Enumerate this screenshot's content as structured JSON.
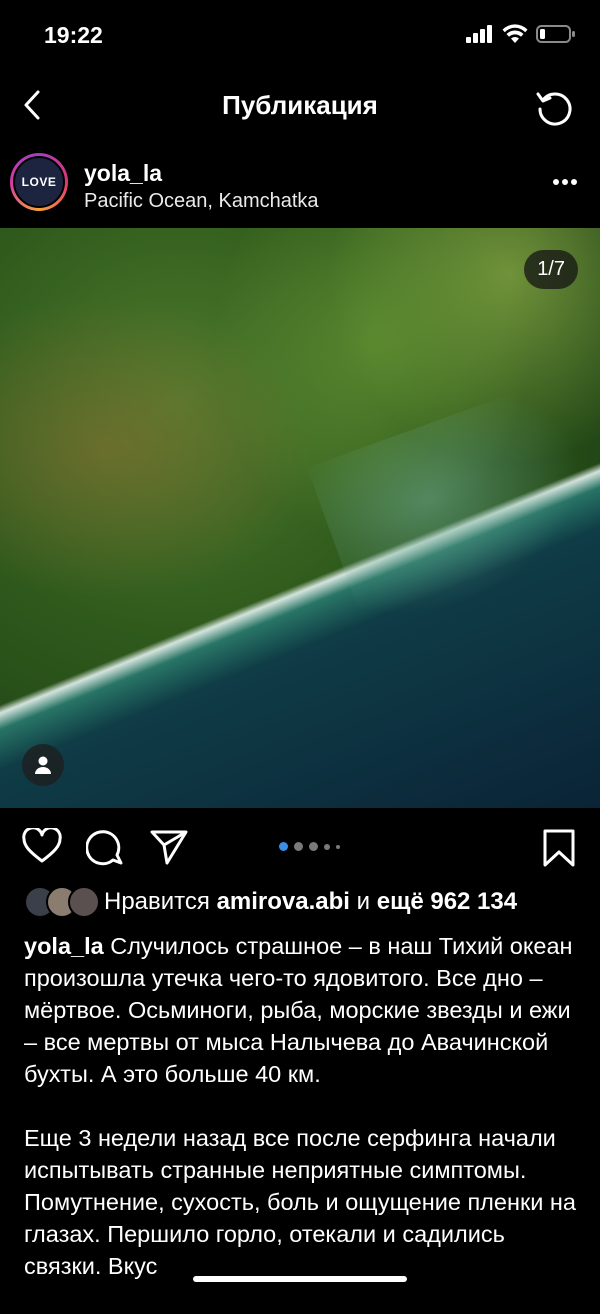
{
  "status_bar": {
    "time": "19:22",
    "signal_icon": "cellular-signal-icon",
    "wifi_icon": "wifi-icon",
    "battery_icon": "battery-low-icon"
  },
  "nav": {
    "title": "Публикация",
    "back_icon": "chevron-left-icon",
    "refresh_icon": "refresh-icon"
  },
  "post": {
    "username": "yola_la",
    "location": "Pacific Ocean, Kamchatka",
    "avatar_text": "LOVE",
    "more_icon": "more-dots-icon",
    "photo_counter": "1/7",
    "carousel": {
      "total_dots": 5,
      "active_index": 0
    }
  },
  "actions": {
    "like_icon": "heart-icon",
    "comment_icon": "comment-icon",
    "share_icon": "send-icon",
    "save_icon": "bookmark-icon"
  },
  "likes": {
    "prefix": "Нравится",
    "user": "amirova.abi",
    "middle": "и",
    "more": "ещё 962 134"
  },
  "caption": {
    "username": "yola_la",
    "paragraph1": "Случилось страшное – в наш Тихий океан произошла утечка чего-то ядовитого. Все дно – мёртвое. Осьминоги, рыба, морские звезды и ежи – все мертвы от мыса Налычева до Авачинской бухты. А это больше 40 км.",
    "paragraph2": "Еще 3 недели назад все после серфинга начали испытывать странные неприятные симптомы. Помутнение, сухость, боль и ощущение пленки на глазах. Першило горло, отекали и садились связки. Вкус"
  },
  "colors": {
    "background": "#000000",
    "text": "#ffffff",
    "carousel_active": "#3a8de5",
    "carousel_inactive": "#7a7a7a"
  }
}
